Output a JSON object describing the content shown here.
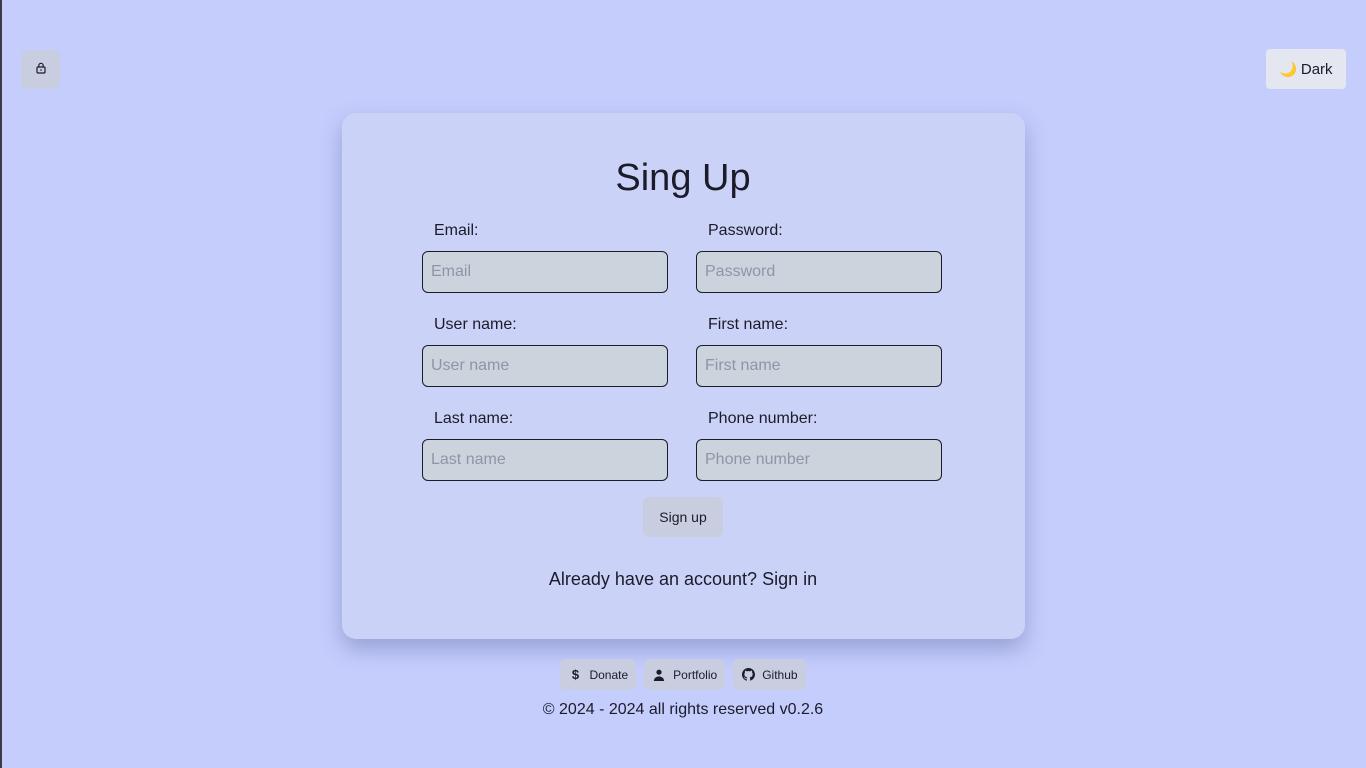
{
  "header": {
    "lock_icon": "lock-icon",
    "theme_toggle": {
      "icon": "moon-icon",
      "glyph": "🌙",
      "label": "Dark"
    }
  },
  "form": {
    "title": "Sing Up",
    "fields": {
      "email": {
        "label": "Email:",
        "placeholder": "Email",
        "value": ""
      },
      "password": {
        "label": "Password:",
        "placeholder": "Password",
        "value": ""
      },
      "username": {
        "label": "User name:",
        "placeholder": "User name",
        "value": ""
      },
      "firstname": {
        "label": "First name:",
        "placeholder": "First name",
        "value": ""
      },
      "lastname": {
        "label": "Last name:",
        "placeholder": "Last name",
        "value": ""
      },
      "phone": {
        "label": "Phone number:",
        "placeholder": "Phone number",
        "value": ""
      }
    },
    "submit_label": "Sign up",
    "signin_prompt": "Already have an account?",
    "signin_link": "Sign in"
  },
  "footer": {
    "links": [
      {
        "label": "Donate",
        "icon": "dollar-icon",
        "glyph": "$"
      },
      {
        "label": "Portfolio",
        "icon": "user-icon"
      },
      {
        "label": "Github",
        "icon": "github-icon"
      }
    ],
    "copyright": "© 2024 - 2024 all rights reserved v0.2.6"
  },
  "colors": {
    "background": "#c4cdfc",
    "card": "#cbd2f7",
    "input": "#cbd3dd",
    "button": "#c9cde0"
  }
}
